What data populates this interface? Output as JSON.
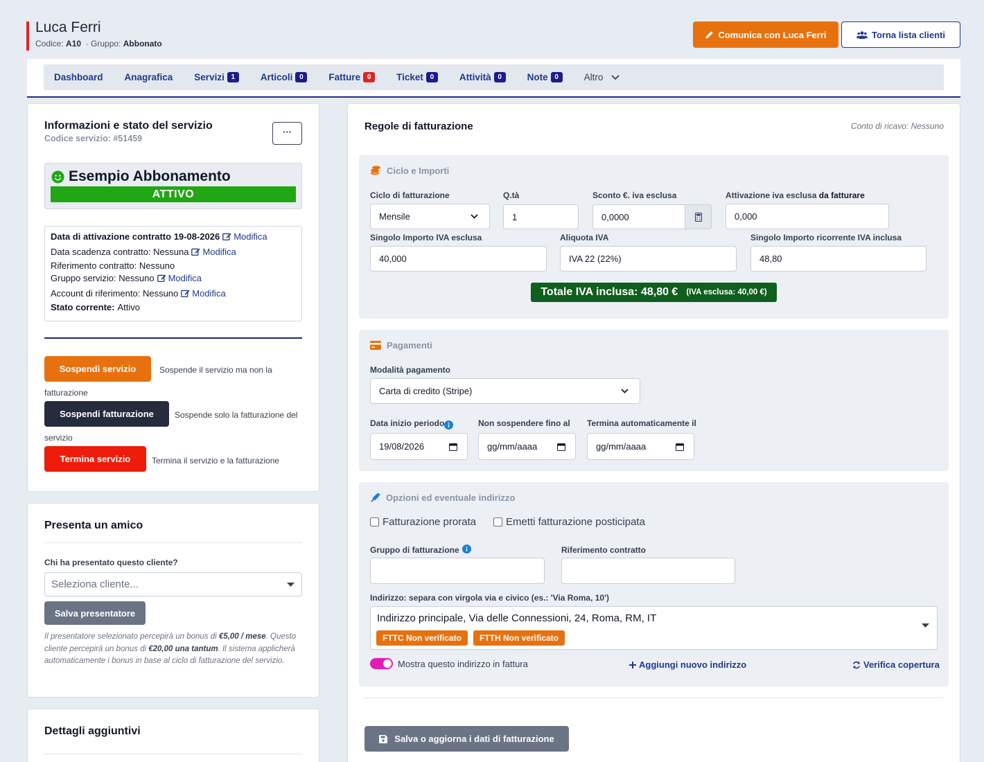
{
  "header": {
    "customer_name": "Luca Ferri",
    "code_label": "Codice:",
    "code_value": "A10",
    "group_label": "· Gruppo:",
    "group_value": "Abbonato",
    "communicate_label": "Comunica con Luca Ferri",
    "back_label": "Torna lista clienti",
    "accent_color": "#dc2626"
  },
  "nav": {
    "items": [
      {
        "label": "Dashboard"
      },
      {
        "label": "Anagrafica"
      },
      {
        "label": "Servizi",
        "badge": "1"
      },
      {
        "label": "Articoli",
        "badge": "0"
      },
      {
        "label": "Fatture",
        "badge": "0"
      },
      {
        "label": "Ticket",
        "badge": "0"
      },
      {
        "label": "Attività",
        "badge": "0"
      },
      {
        "label": "Note",
        "badge": "0"
      },
      {
        "label": "Altro"
      }
    ]
  },
  "service_info": {
    "title": "Informazioni e stato del servizio",
    "code": "Codice servizio: #51459",
    "menu_label": "···",
    "service_name": "Esempio Abbonamento",
    "status": "ATTIVO",
    "status_color": "#22a714",
    "lines": {
      "activation": "Data di attivazione contratto 19-08-2026",
      "expiry": "Data scadenza contratto: Nessuna",
      "reference": "Riferimento contratto: Nessuno",
      "group": "Gruppo servizio: Nessuno",
      "account": "Account di riferimento: Nessuno",
      "state_label": "Stato corrente:",
      "state_value": "Attivo"
    },
    "edit_label": "Modifica",
    "actions": {
      "suspend_label": "Sospendi servizio",
      "suspend_desc_1": "Sospende il servizio ma non la",
      "suspend_desc_2": "fatturazione",
      "suspend_billing_label": "Sospendi fatturazione",
      "suspend_billing_desc_1": "Sospende solo la fatturazione del",
      "suspend_billing_desc_2": "servizio",
      "terminate_label": "Termina servizio",
      "terminate_desc": "Termina il servizio e la fatturazione"
    }
  },
  "referral": {
    "title": "Presenta un amico",
    "question": "Chi ha presentato questo cliente?",
    "placeholder": "Seleziona cliente...",
    "save_label": "Salva presentatore",
    "note_1": "Il presentatore selezionato percepirà un bonus di",
    "note_bonus_1": "€5,00 / mese",
    "note_2": ". Questo cliente percepirà un bonus di",
    "note_bonus_2": "€20,00 una tantum",
    "note_3": ". Il sistema applicherà automaticamente i bonus in base al ciclo di fatturazione del servizio."
  },
  "details": {
    "title": "Dettagli aggiuntivi"
  },
  "billing": {
    "title": "Regole di fatturazione",
    "revenue_account": "Conto di ricavo: Nessuno",
    "cycle_section": {
      "title": "Ciclo e Importi",
      "cycle_label": "Ciclo di fatturazione",
      "cycle_value": "Mensile",
      "qty_label": "Q.tà",
      "qty_value": "1",
      "discount_label": "Sconto €. iva esclusa",
      "discount_value": "0,0000",
      "activation_label": "Attivazione iva esclusa",
      "activation_label_bold": "da fatturare",
      "activation_value": "0,000",
      "unit_price_label": "Singolo Importo IVA esclusa",
      "unit_price_value": "40,000",
      "vat_label": "Aliquota IVA",
      "vat_value": "IVA 22 (22%)",
      "recurring_label": "Singolo Importo ricorrente IVA inclusa",
      "recurring_value": "48,80",
      "total_label": "Totale IVA inclusa: 48,80 €",
      "total_sub": "(IVA esclusa: 40,00 €)",
      "total_color": "#0f5f1e"
    },
    "payments_section": {
      "title": "Pagamenti",
      "method_label": "Modalità pagamento",
      "method_value": "Carta di credito (Stripe)",
      "start_label": "Data inizio periodo",
      "start_value": "19/08/2026",
      "no_suspend_label": "Non sospendere fino al",
      "no_suspend_value": "gg/mm/aaaa",
      "auto_end_label": "Termina automaticamente il",
      "auto_end_value": "gg/mm/aaaa"
    },
    "options_section": {
      "title": "Opzioni ed eventuale indirizzo",
      "prorata_label": "Fatturazione prorata",
      "postponed_label": "Emetti fatturazione posticipata",
      "billing_group_label": "Gruppo di fatturazione",
      "contract_ref_label": "Riferimento contratto",
      "address_label": "Indirizzo: separa con virgola via e civico (es.: 'Via Roma, 10')",
      "address_value": "Indirizzo principale, Via delle Connessioni, 24, Roma, RM, IT",
      "tag_fttc": "FTTC Non verificato",
      "tag_ftth": "FTTH Non verificato",
      "show_address_label": "Mostra questo indirizzo in fattura",
      "add_address_label": "Aggiungi nuovo indirizzo",
      "verify_label": "Verifica copertura"
    },
    "save_label": "Salva o aggiorna i dati di fatturazione"
  }
}
